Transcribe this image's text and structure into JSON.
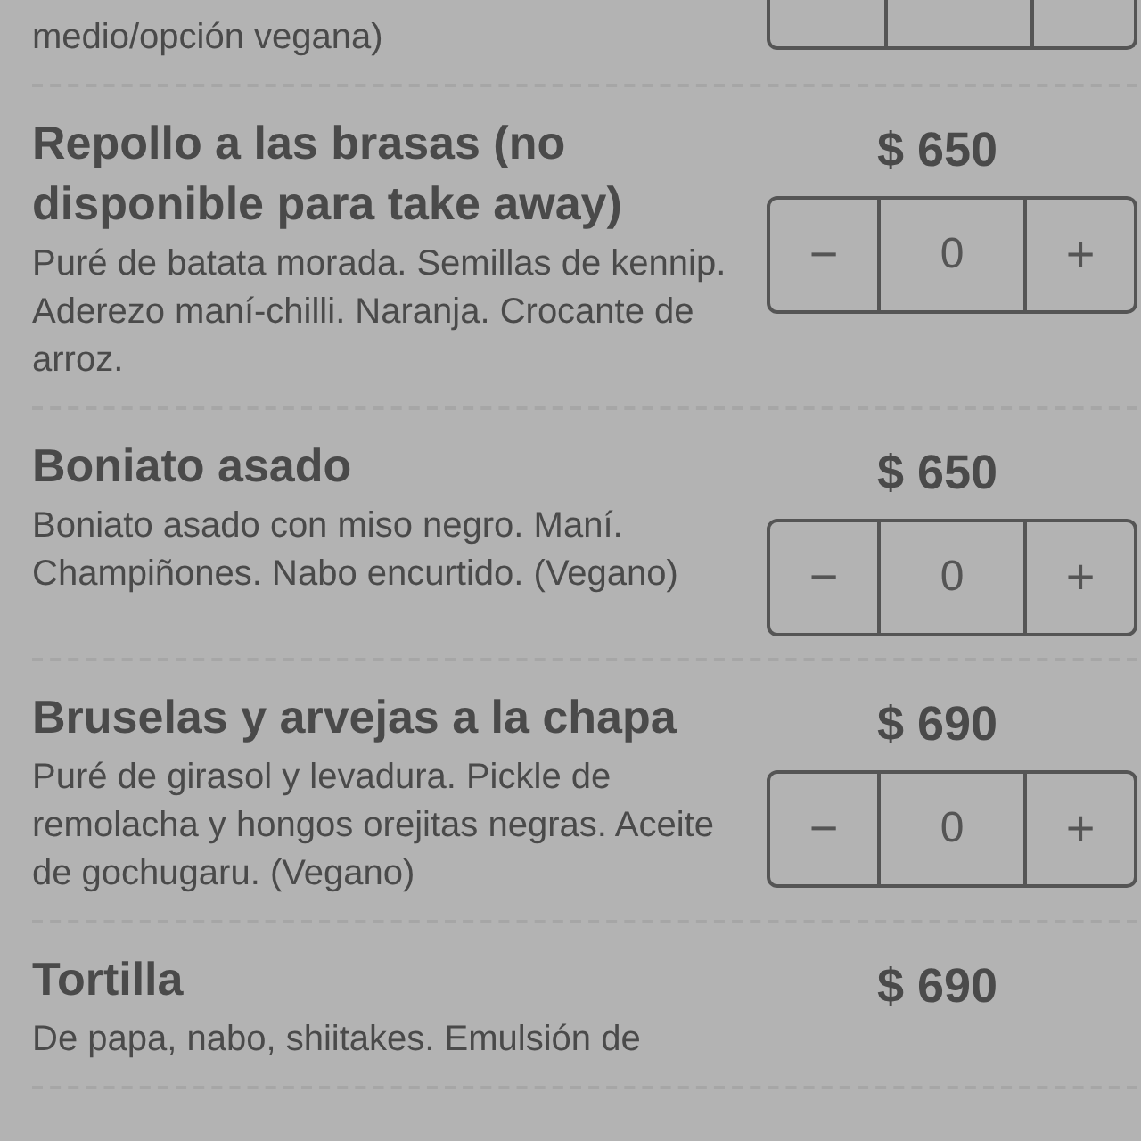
{
  "items": [
    {
      "kind": "cut_off",
      "description": "medio/opción vegana)"
    },
    {
      "kind": "full",
      "name": "Repollo a las brasas (no disponible para take away)",
      "price": "$ 650",
      "description": "Puré de batata morada. Semillas de kennip. Aderezo maní-chilli. Naranja. Crocante de arroz.",
      "minus": "−",
      "quantity": "0",
      "plus": "+"
    },
    {
      "kind": "full",
      "name": "Boniato asado",
      "price": "$ 650",
      "description": "Boniato asado con miso negro. Maní. Champiñones. Nabo encurtido. (Vegano)",
      "minus": "−",
      "quantity": "0",
      "plus": "+"
    },
    {
      "kind": "full",
      "name": "Bruselas y arvejas a la chapa",
      "price": "$ 690",
      "description": "Puré de girasol y levadura. Pickle de remolacha y hongos orejitas negras. Aceite de gochugaru. (Vegano)",
      "minus": "−",
      "quantity": "0",
      "plus": "+"
    },
    {
      "kind": "full",
      "name": "Tortilla",
      "price": "$ 690",
      "description": "De papa, nabo, shiitakes. Emulsión de"
    }
  ]
}
